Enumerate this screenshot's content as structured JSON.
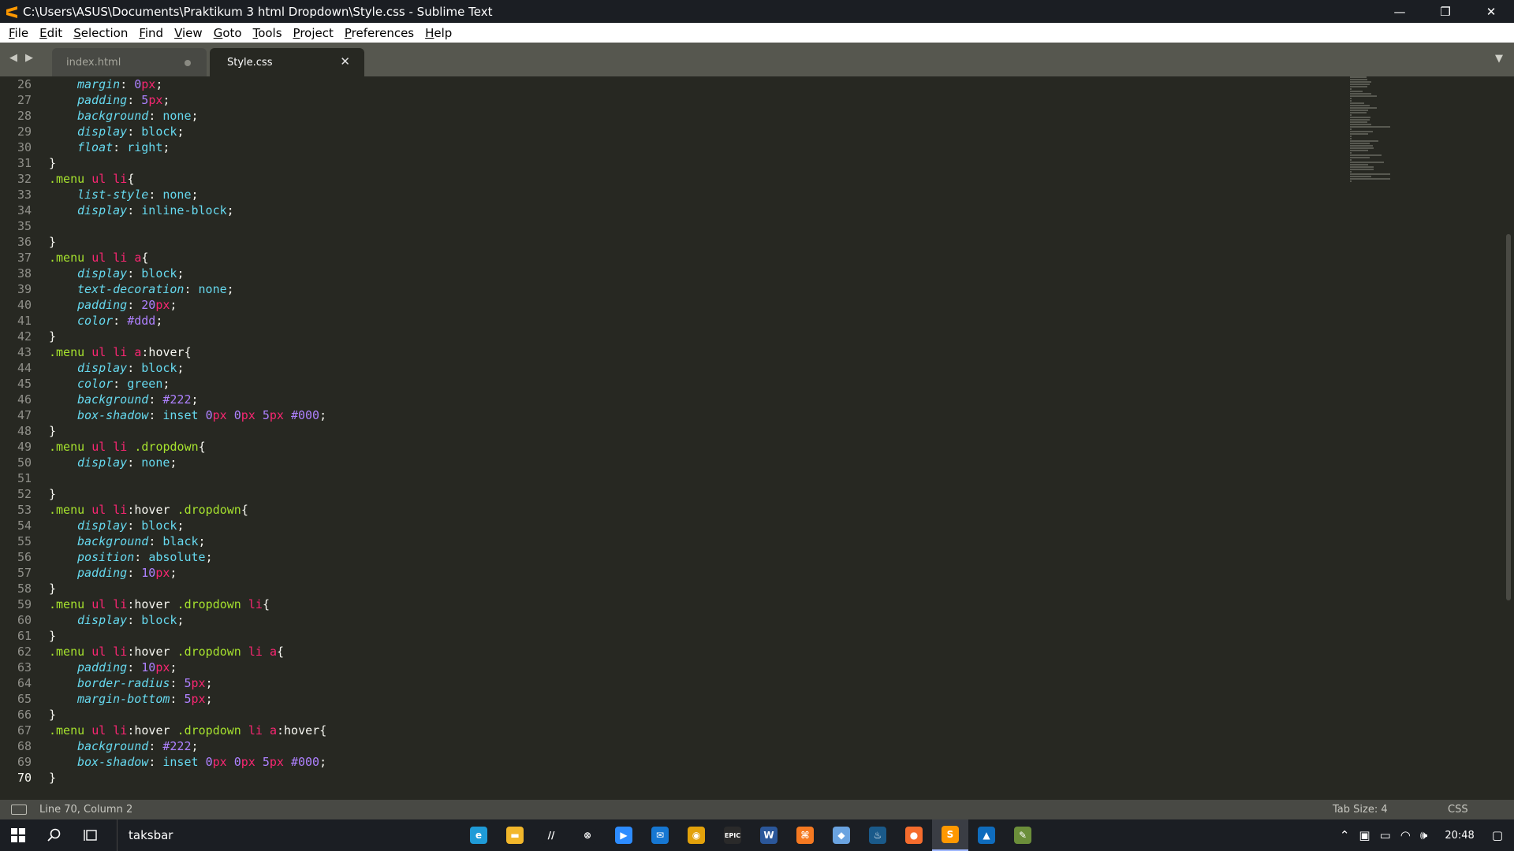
{
  "window": {
    "title": "C:\\Users\\ASUS\\Documents\\Praktikum 3 html Dropdown\\Style.css - Sublime Text",
    "minimize": "—",
    "restore": "❐",
    "close": "✕"
  },
  "menu": [
    {
      "label": "File"
    },
    {
      "label": "Edit"
    },
    {
      "label": "Selection"
    },
    {
      "label": "Find"
    },
    {
      "label": "View"
    },
    {
      "label": "Goto"
    },
    {
      "label": "Tools"
    },
    {
      "label": "Project"
    },
    {
      "label": "Preferences"
    },
    {
      "label": "Help"
    }
  ],
  "tabs": [
    {
      "label": "index.html",
      "dirty": true
    },
    {
      "label": "Style.css",
      "active": true,
      "close": "✕"
    }
  ],
  "editor": {
    "first_line": 26,
    "current_line": 70,
    "line_numbers": [
      "26",
      "27",
      "28",
      "29",
      "30",
      "31",
      "32",
      "33",
      "34",
      "35",
      "36",
      "37",
      "38",
      "39",
      "40",
      "41",
      "42",
      "43",
      "44",
      "45",
      "46",
      "47",
      "48",
      "49",
      "50",
      "51",
      "52",
      "53",
      "54",
      "55",
      "56",
      "57",
      "58",
      "59",
      "60",
      "61",
      "62",
      "63",
      "64",
      "65",
      "66",
      "67",
      "68",
      "69",
      "70"
    ],
    "lines": [
      "    margin: 0px;",
      "    padding: 5px;",
      "    background: none;",
      "    display: block;",
      "    float: right;",
      "}",
      ".menu ul li{",
      "    list-style: none;",
      "    display: inline-block;",
      "",
      "}",
      ".menu ul li a{",
      "    display: block;",
      "    text-decoration: none;",
      "    padding: 20px;",
      "    color: #ddd;",
      "}",
      ".menu ul li a:hover{",
      "    display: block;",
      "    color: green;",
      "    background: #222;",
      "    box-shadow: inset 0px 0px 5px #000;",
      "}",
      ".menu ul li .dropdown{",
      "    display: none;",
      "",
      "}",
      ".menu ul li:hover .dropdown{",
      "    display: block;",
      "    background: black;",
      "    position: absolute;",
      "    padding: 10px;",
      "}",
      ".menu ul li:hover .dropdown li{",
      "    display: block;",
      "}",
      ".menu ul li:hover .dropdown li a{",
      "    padding: 10px;",
      "    border-radius: 5px;",
      "    margin-bottom: 5px;",
      "}",
      ".menu ul li:hover .dropdown li a:hover{",
      "    background: #222;",
      "    box-shadow: inset 0px 0px 5px #000;",
      "}"
    ]
  },
  "statusbar": {
    "position": "Line 70, Column 2",
    "tab_size": "Tab Size: 4",
    "syntax": "CSS"
  },
  "taskbar": {
    "search_text": "taksbar",
    "apps": [
      {
        "name": "edge-icon",
        "color": "#1f9bd7",
        "glyph": "e"
      },
      {
        "name": "file-explorer-icon",
        "color": "#f2b72b",
        "glyph": "▬"
      },
      {
        "name": "app-slash-icon",
        "color": "#1b1e23",
        "glyph": "//"
      },
      {
        "name": "xbox-icon",
        "color": "#1b1e23",
        "glyph": "⊗"
      },
      {
        "name": "zoom-icon",
        "color": "#2d8cff",
        "glyph": "▶"
      },
      {
        "name": "mail-icon",
        "color": "#1677d2",
        "glyph": "✉"
      },
      {
        "name": "chrome-icon",
        "color": "#e3a20b",
        "glyph": "◉"
      },
      {
        "name": "epic-games-icon",
        "color": "#2a2a2a",
        "glyph": "EPIC"
      },
      {
        "name": "word-icon",
        "color": "#2b579a",
        "glyph": "W"
      },
      {
        "name": "xampp-icon",
        "color": "#f57921",
        "glyph": "⌘"
      },
      {
        "name": "virtualbox-icon",
        "color": "#6aa3e0",
        "glyph": "◆"
      },
      {
        "name": "steam-icon",
        "color": "#1a5a8a",
        "glyph": "♨"
      },
      {
        "name": "origin-icon",
        "color": "#f56c2d",
        "glyph": "●"
      },
      {
        "name": "sublime-text-icon",
        "color": "#ff9800",
        "glyph": "S",
        "active": true
      },
      {
        "name": "photos-icon",
        "color": "#0f6cbd",
        "glyph": "▲"
      },
      {
        "name": "paint-icon",
        "color": "#6b8e3a",
        "glyph": "✎"
      }
    ],
    "clock": "20:48"
  },
  "colors": {
    "editor_bg": "#272822",
    "property": "#66d9ef",
    "number": "#ae81ff",
    "keyword": "#f92672",
    "selector": "#a6e22e",
    "titlebar": "#1b1e23"
  }
}
